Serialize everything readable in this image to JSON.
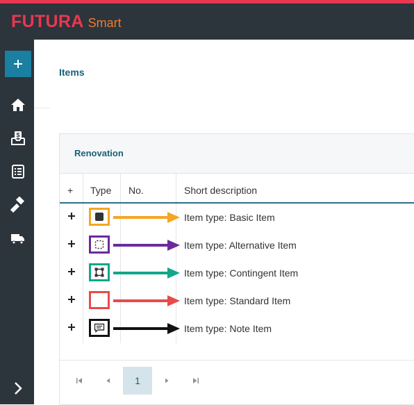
{
  "app": {
    "brand_main": "FUTURA",
    "brand_sub": "Smart"
  },
  "colors": {
    "topline": "#e8384f",
    "header_bg": "#2c343c",
    "accent": "#1a7fa0",
    "title": "#16617a",
    "basic": "#f5a623",
    "alternative": "#6a2a9c",
    "contingent": "#12a68a",
    "standard": "#e84a4a",
    "note": "#111111"
  },
  "sidebar": {
    "items": [
      {
        "icon": "plus-icon"
      },
      {
        "icon": "home-icon"
      },
      {
        "icon": "inbox-money-icon"
      },
      {
        "icon": "checklist-icon"
      },
      {
        "icon": "hammer-icon"
      },
      {
        "icon": "truck-icon"
      },
      {
        "icon": "chevron-right-icon"
      }
    ]
  },
  "page": {
    "title": "Items"
  },
  "panel": {
    "title": "Renovation",
    "columns": {
      "plus": "+",
      "type": "Type",
      "no": "No.",
      "description": "Short description"
    },
    "rows": [
      {
        "type_icon": "basic-item-icon",
        "no": "",
        "description": "Item type: Basic Item",
        "color": "#f5a623"
      },
      {
        "type_icon": "alternative-item-icon",
        "no": "",
        "description": "Item type: Alternative Item",
        "color": "#6a2a9c"
      },
      {
        "type_icon": "contingent-item-icon",
        "no": "",
        "description": "Item type: Contingent Item",
        "color": "#12a68a"
      },
      {
        "type_icon": "standard-item-icon",
        "no": "",
        "description": "Item type: Standard Item",
        "color": "#e84a4a"
      },
      {
        "type_icon": "note-item-icon",
        "no": "",
        "description": "Item type: Note Item",
        "color": "#111111"
      }
    ]
  },
  "pagination": {
    "current_page": "1"
  }
}
